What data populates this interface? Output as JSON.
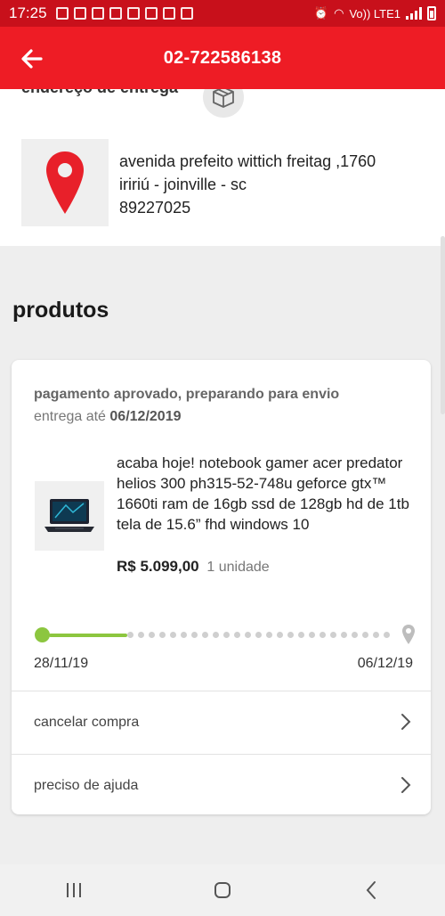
{
  "status_bar": {
    "time": "17:25",
    "network_label": "Vo)) LTE1"
  },
  "header": {
    "title": "02-722586138",
    "back_icon": "arrow-left-icon"
  },
  "address": {
    "heading": "endereço de entrega",
    "line1": "avenida prefeito wittich freitag ,1760",
    "line2": "iririú - joinville - sc",
    "line3": "89227025",
    "pin_color": "#e8202a"
  },
  "products_section": {
    "title": "produtos"
  },
  "order": {
    "status": "pagamento aprovado, preparando para envio",
    "delivery_label": "entrega até",
    "delivery_date": "06/12/2019",
    "product_description": "acaba hoje! notebook gamer acer predator helios 300 ph315-52-748u geforce gtx™ 1660ti ram de 16gb ssd de 128gb hd de 1tb tela de 15.6” fhd windows 10",
    "price": "R$ 5.099,00",
    "quantity": "1 unidade",
    "tracking": {
      "start_date": "28/11/19",
      "end_date": "06/12/19",
      "progress": 0.22,
      "accent": "#8cc63f"
    }
  },
  "actions": [
    {
      "label": "cancelar compra"
    },
    {
      "label": "preciso de ajuda"
    }
  ],
  "colors": {
    "brand": "#ee1c25",
    "status_bar": "#c8101b"
  }
}
